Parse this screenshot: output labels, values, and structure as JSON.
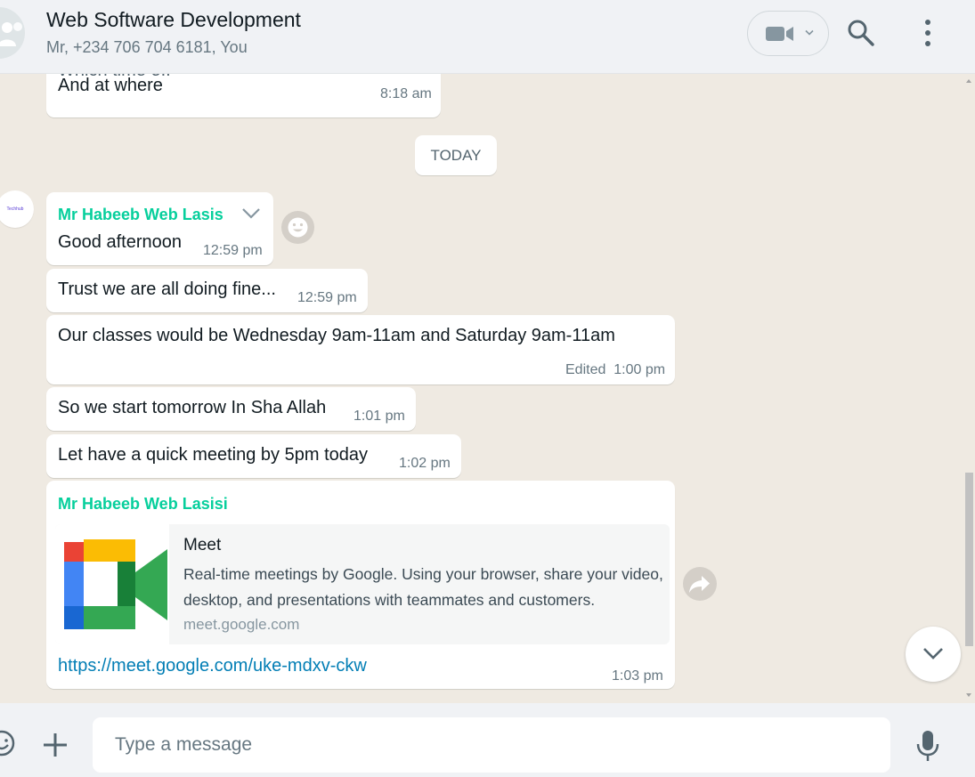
{
  "header": {
    "title": "Web Software Development",
    "subtitle": "Mr, +234 706 704 6181, You",
    "icons": {
      "avatar": "group-icon",
      "video": "video-camera-icon",
      "search": "search-icon",
      "menu": "menu-dots-icon"
    }
  },
  "messages": {
    "m0": {
      "partial": "Which time o..",
      "text": "And at where",
      "time": "8:18 am"
    },
    "date_chip": "TODAY",
    "m1": {
      "sender": "Mr Habeeb Web Lasis",
      "text": "Good afternoon",
      "time": "12:59 pm",
      "avatar_label": "Techhub"
    },
    "m2": {
      "text": "Trust we are all doing fine...",
      "time": "12:59 pm"
    },
    "m3": {
      "text": "Our classes would be Wednesday 9am-11am and Saturday 9am-11am",
      "time": "Edited  1:00 pm"
    },
    "m4": {
      "text": "So we start tomorrow In Sha Allah",
      "time": "1:01 pm"
    },
    "m5": {
      "text": "Let have a quick meeting by 5pm today",
      "time": "1:02 pm"
    },
    "m6": {
      "sender": "Mr Habeeb Web Lasisi",
      "preview_title": "Meet",
      "preview_desc": "Real-time meetings by Google. Using your browser, share your video, desktop, and presentations with teammates and customers.",
      "preview_domain": "meet.google.com",
      "link": "https://meet.google.com/uke-mdxv-ckw",
      "time": "1:03 pm"
    }
  },
  "composer": {
    "placeholder": "Type a message",
    "icons": {
      "emoji": "emoji-icon",
      "attach": "plus-icon",
      "mic": "microphone-icon"
    }
  },
  "colors": {
    "header_bg": "#f0f2f5",
    "chat_bg": "#efeae2",
    "bubble_bg": "#ffffff",
    "sender_name": "#06cf9c",
    "link": "#027eb5",
    "meta_text": "#667781"
  }
}
